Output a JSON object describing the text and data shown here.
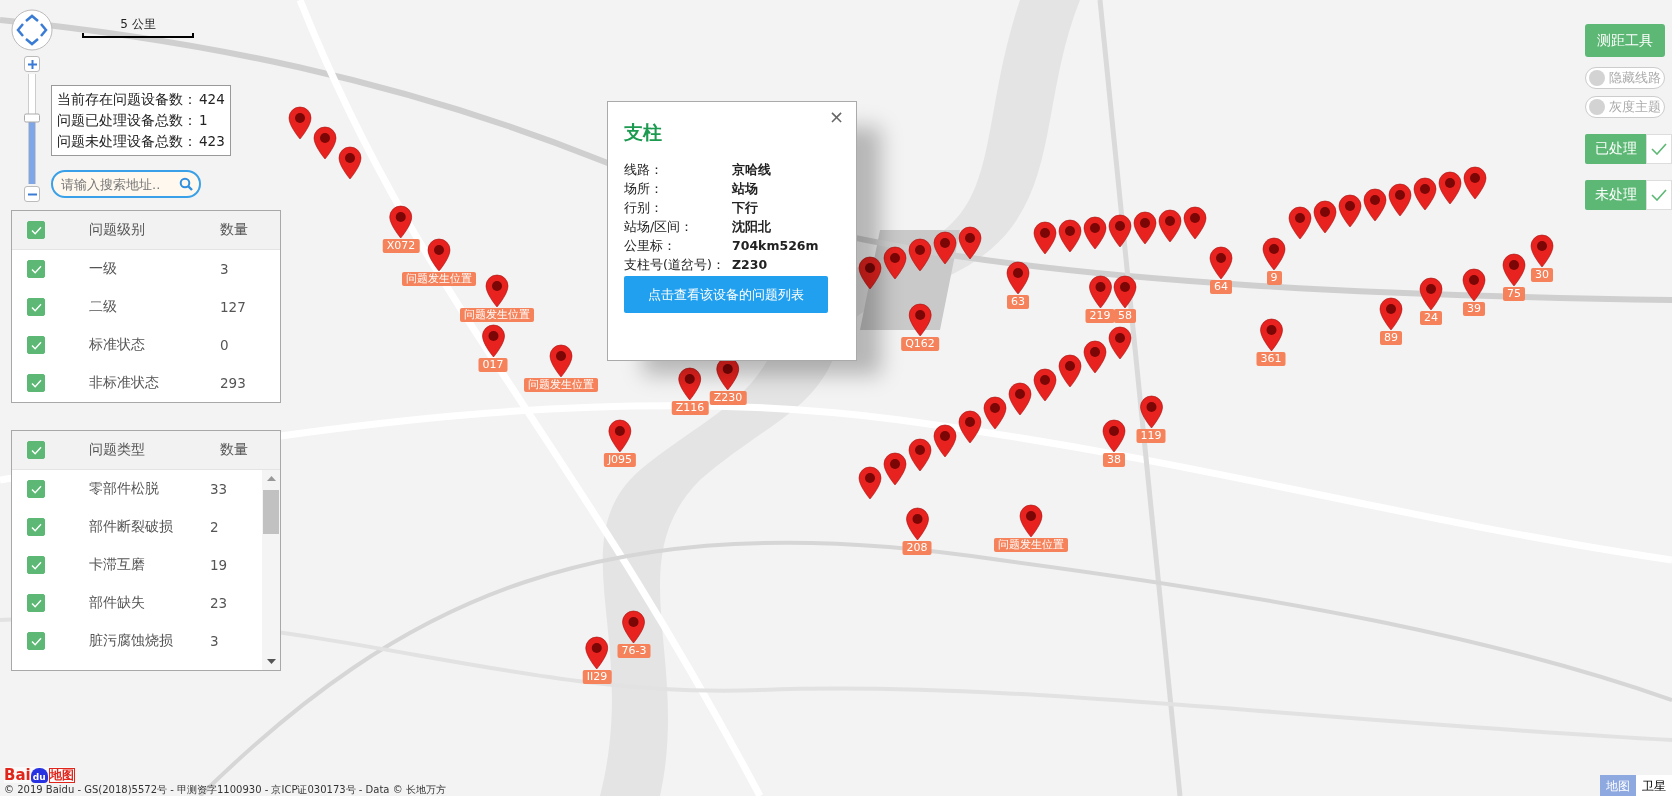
{
  "scale_bar": {
    "label": "5 公里"
  },
  "zoom_slider": {
    "level": 0.6
  },
  "stats": [
    {
      "label": "当前存在问题设备数：",
      "value": "424"
    },
    {
      "label": "问题已处理设备总数：",
      "value": "1"
    },
    {
      "label": "问题未处理设备总数：",
      "value": "423"
    }
  ],
  "search": {
    "placeholder": "请输入搜索地址.."
  },
  "level_table": {
    "columns": [
      "问题级别",
      "数量"
    ],
    "all_checked": true,
    "rows": [
      {
        "label": "一级",
        "count": "3",
        "checked": true
      },
      {
        "label": "二级",
        "count": "127",
        "checked": true
      },
      {
        "label": "标准状态",
        "count": "0",
        "checked": true
      },
      {
        "label": "非标准状态",
        "count": "293",
        "checked": true
      }
    ]
  },
  "type_table": {
    "columns": [
      "问题类型",
      "数量"
    ],
    "all_checked": true,
    "rows": [
      {
        "label": "零部件松脱",
        "count": "33",
        "checked": true
      },
      {
        "label": "部件断裂破损",
        "count": "2",
        "checked": true
      },
      {
        "label": "卡滞互磨",
        "count": "19",
        "checked": true
      },
      {
        "label": "部件缺失",
        "count": "23",
        "checked": true
      },
      {
        "label": "脏污腐蚀烧损",
        "count": "3",
        "checked": true
      }
    ]
  },
  "popup": {
    "title": "支柱",
    "close": "×",
    "fields": [
      {
        "label": "线路：",
        "value": "京哈线"
      },
      {
        "label": "场所：",
        "value": "站场"
      },
      {
        "label": "行别：",
        "value": "下行"
      },
      {
        "label": "站场/区间：",
        "value": "沈阳北"
      },
      {
        "label": "公里标：",
        "value": "704km526m"
      },
      {
        "label": "支柱号(道岔号)：",
        "value": "Z230"
      }
    ],
    "button": "点击查看该设备的问题列表"
  },
  "markers": [
    {
      "label": "X072"
    },
    {
      "label": "问题发生位置"
    },
    {
      "label": "问题发生位置"
    },
    {
      "label": "017"
    },
    {
      "label": "问题发生位置"
    },
    {
      "label": "J095"
    },
    {
      "label": "Z116"
    },
    {
      "label": "Z230"
    },
    {
      "label": "Q162"
    },
    {
      "label": "63"
    },
    {
      "label": "219"
    },
    {
      "label": "58"
    },
    {
      "label": "64"
    },
    {
      "label": "9"
    },
    {
      "label": "361"
    },
    {
      "label": "89"
    },
    {
      "label": "24"
    },
    {
      "label": "39"
    },
    {
      "label": "75"
    },
    {
      "label": "30"
    },
    {
      "label": "119"
    },
    {
      "label": "38"
    },
    {
      "label": "208"
    },
    {
      "label": "问题发生位置"
    },
    {
      "label": "76-3"
    },
    {
      "label": "II29"
    }
  ],
  "tools": {
    "measure_button": "测距工具",
    "toggles": [
      {
        "label": "隐藏线路",
        "on": false
      },
      {
        "label": "灰度主题",
        "on": false
      }
    ],
    "filters": [
      {
        "label": "已处理",
        "checked": true
      },
      {
        "label": "未处理",
        "checked": true
      }
    ]
  },
  "map_types": [
    {
      "label": "地图",
      "selected": true
    },
    {
      "label": "卫星",
      "selected": false
    }
  ],
  "logo": {
    "left": "Bai",
    "paw": "du",
    "right": "地图"
  },
  "attribution": "© 2019 Baidu - GS(2018)5572号 - 甲测资字1100930 - 京ICP证030173号 - Data © 长地万方"
}
